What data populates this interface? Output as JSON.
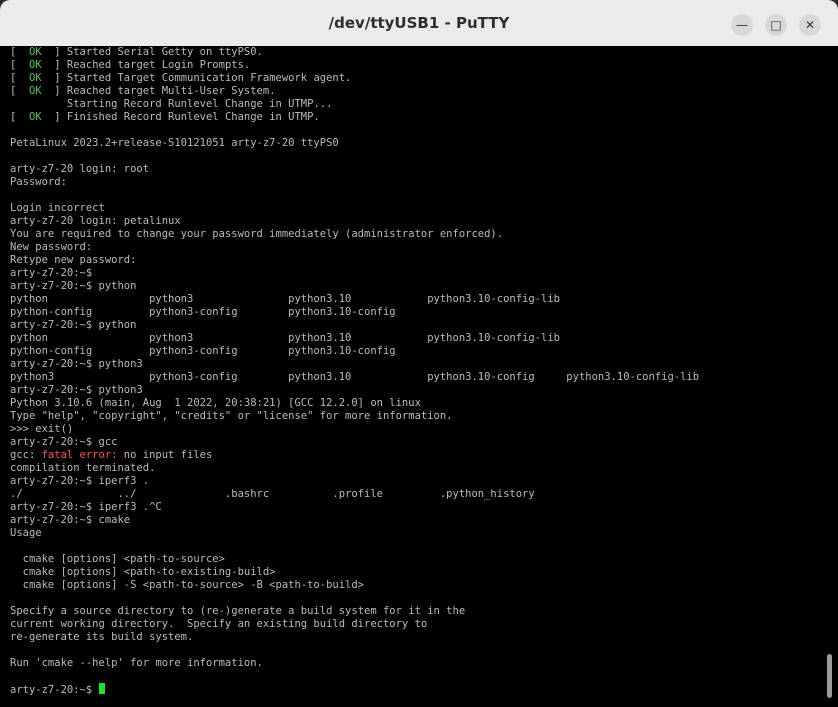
{
  "window": {
    "title": "/dev/ttyUSB1 - PuTTY",
    "minimize_symbol": "—",
    "maximize_symbol": "□",
    "close_symbol": "✕"
  },
  "terminal": {
    "lines": [
      "[  OK  ] Started Serial Getty on ttyPS0.",
      "[  OK  ] Reached target Login Prompts.",
      "[  OK  ] Started Target Communication Framework agent.",
      "[  OK  ] Reached target Multi-User System.",
      "         Starting Record Runlevel Change in UTMP...",
      "[  OK  ] Finished Record Runlevel Change in UTMP.",
      "",
      "PetaLinux 2023.2+release-S10121051 arty-z7-20 ttyPS0",
      "",
      "arty-z7-20 login: root",
      "Password:",
      "",
      "Login incorrect",
      "arty-z7-20 login: petalinux",
      "You are required to change your password immediately (administrator enforced).",
      "New password:",
      "Retype new password:",
      "arty-z7-20:~$",
      "arty-z7-20:~$ python",
      "python                python3               python3.10            python3.10-config-lib",
      "python-config         python3-config        python3.10-config",
      "arty-z7-20:~$ python",
      "python                python3               python3.10            python3.10-config-lib",
      "python-config         python3-config        python3.10-config",
      "arty-z7-20:~$ python3",
      "python3               python3-config        python3.10            python3.10-config     python3.10-config-lib",
      "arty-z7-20:~$ python3",
      "Python 3.10.6 (main, Aug  1 2022, 20:38:21) [GCC 12.2.0] on linux",
      "Type \"help\", \"copyright\", \"credits\" or \"license\" for more information.",
      ">>> exit()",
      "arty-z7-20:~$ gcc",
      "gcc: fatal error: no input files",
      "compilation terminated.",
      "arty-z7-20:~$ iperf3 .",
      "./               ../              .bashrc          .profile         .python_history",
      "arty-z7-20:~$ iperf3 .^C",
      "arty-z7-20:~$ cmake",
      "Usage",
      "",
      "  cmake [options] <path-to-source>",
      "  cmake [options] <path-to-existing-build>",
      "  cmake [options] -S <path-to-source> -B <path-to-build>",
      "",
      "Specify a source directory to (re-)generate a build system for it in the",
      "current working directory.  Specify an existing build directory to",
      "re-generate its build system.",
      "",
      "Run 'cmake --help' for more information.",
      "",
      "arty-z7-20:~$ "
    ],
    "colors": {
      "background": "#000000",
      "text": "#bbbbbb",
      "ok": "#54c154",
      "error": "#ff5555",
      "cursor": "#22dd22"
    }
  }
}
